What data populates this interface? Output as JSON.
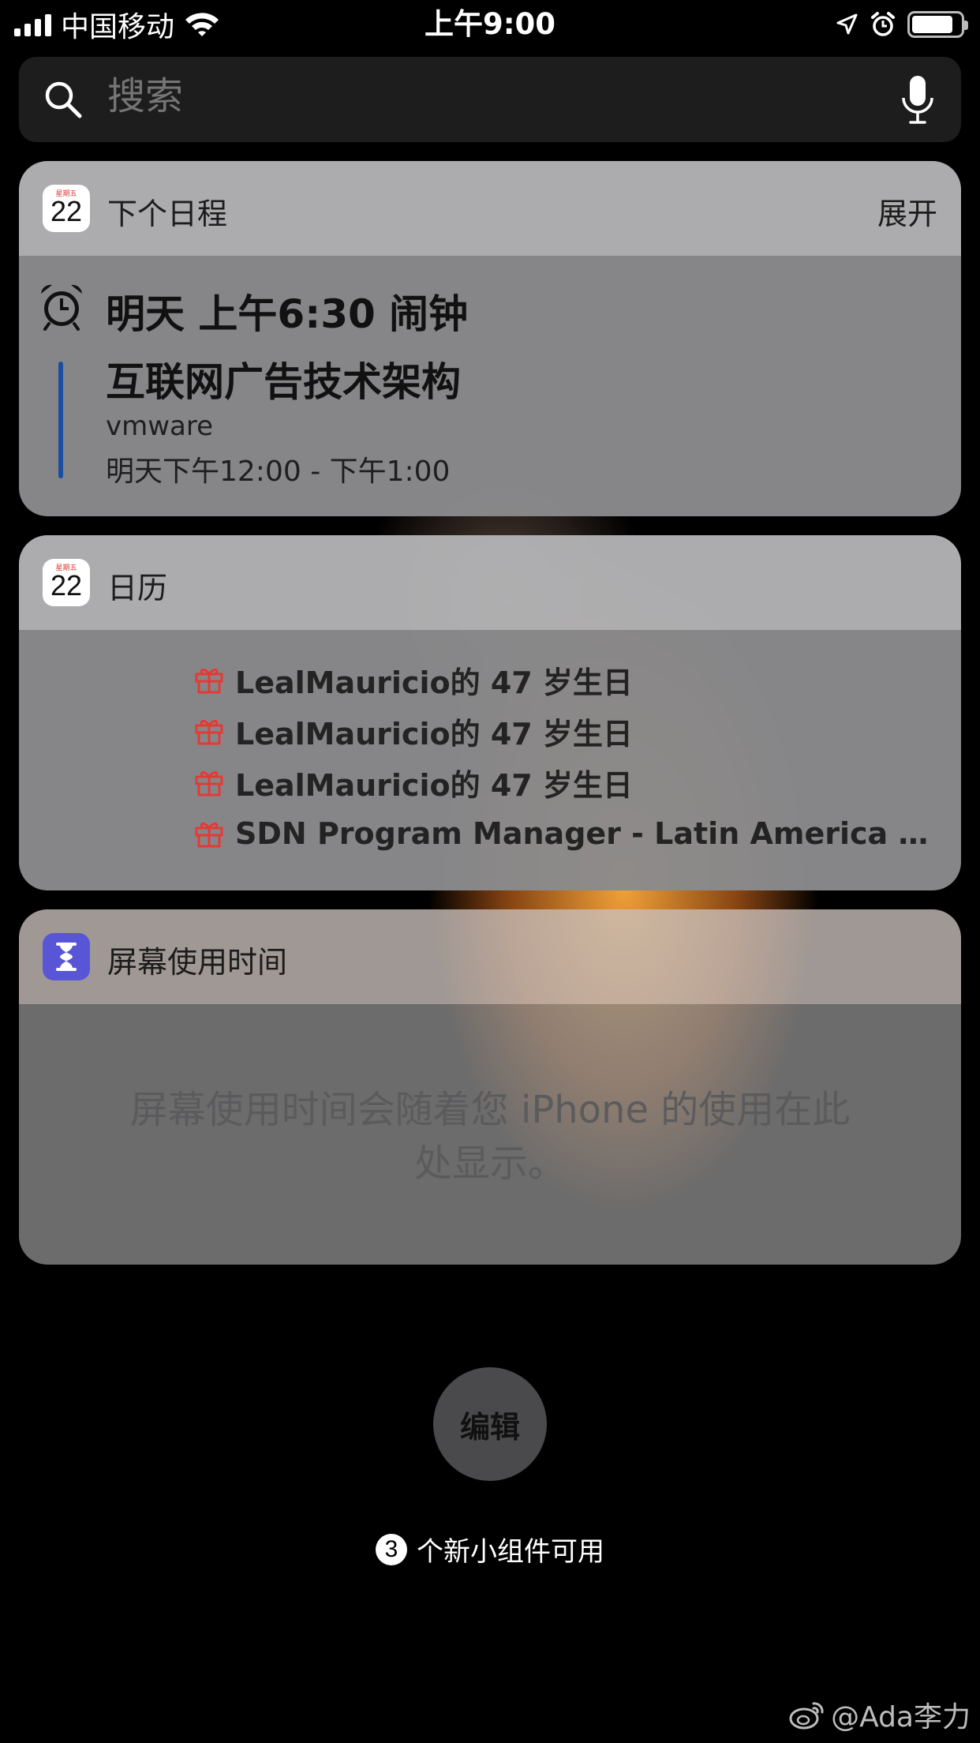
{
  "status_bar": {
    "carrier": "中国移动",
    "time": "上午9:00",
    "signal_bars": 4,
    "battery_level": 0.85
  },
  "search": {
    "placeholder": "搜索",
    "icon": "search-icon",
    "mic_icon": "microphone-icon"
  },
  "widgets": {
    "up_next": {
      "icon_day": "星期五",
      "icon_date": "22",
      "title": "下个日程",
      "expand_label": "展开",
      "alarm": "明天 上午6:30 闹钟",
      "event_title": "互联网广告技术架构",
      "event_location": "vmware",
      "event_time": "明天下午12:00 - 下午1:00",
      "event_color": "#1a4fa0"
    },
    "calendar": {
      "icon_day": "星期五",
      "icon_date": "22",
      "title": "日历",
      "items": [
        {
          "text": "LealMauricio的 47 岁生日"
        },
        {
          "text": "LealMauricio的 47 岁生日"
        },
        {
          "text": "LealMauricio的 47 岁生日"
        },
        {
          "text": "SDN Program Manager - Latin America LealMa..."
        }
      ],
      "gift_color": "#e53935"
    },
    "screen_time": {
      "title": "屏幕使用时间",
      "message": "屏幕使用时间会随着您 iPhone 的使用在此处显示。",
      "icon_color": "#5856d6"
    }
  },
  "edit_label": "编辑",
  "new_widgets": {
    "count": "3",
    "text": "个新小组件可用"
  },
  "watermark": "@Ada李力"
}
